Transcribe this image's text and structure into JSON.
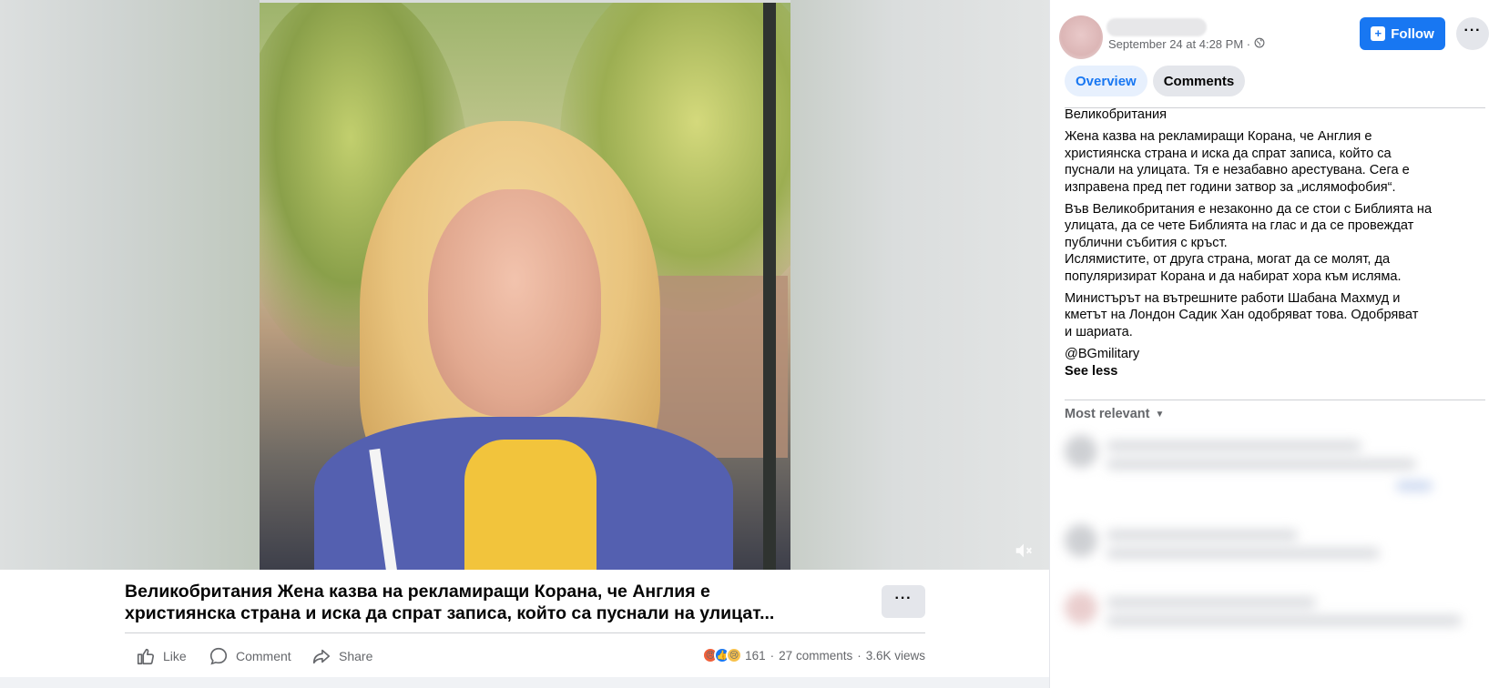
{
  "video": {
    "caption_line1": "Великобритания Жена казва на рекламиращи Корана, че Англия е",
    "caption_line2": "християнска страна и иска да спрат записа, който са пуснали на улицат...",
    "more_label": "···",
    "mute_icon": "mute-icon"
  },
  "actions": {
    "like_label": "Like",
    "comment_label": "Comment",
    "share_label": "Share",
    "reaction_count": "161",
    "comments_count": "27 comments",
    "views": "3.6K views",
    "separator": "·"
  },
  "post": {
    "timestamp": "September 24 at 4:28 PM ·",
    "follow_label": "Follow",
    "more_label": "···",
    "tabs": [
      {
        "label": "Overview"
      },
      {
        "label": "Comments"
      }
    ],
    "paragraphs": [
      [
        "Великобритания"
      ],
      [
        "Жена казва на рекламиращи Корана, че Англия е",
        "християнска страна и иска да спрат записа, който са",
        "пуснали на улицата. Тя е незабавно арестувана. Сега е",
        "изправена пред пет години затвор за „ислямофобия“."
      ],
      [
        "Във Великобритания е незаконно да се стои с Библията на",
        "улицата, да се чете Библията на глас и да се провеждат",
        "публични събития с кръст.",
        "Ислямистите, от друга страна, могат да се молят, да",
        "популяризират Корана и да набират хора към исляма."
      ],
      [
        "Министърът на вътрешните работи Шабана Махмуд и",
        "кметът на Лондон Садик Хан одобряват това. Одобряват",
        "и шариата."
      ]
    ],
    "mention": "@BGmilitary",
    "see_less": "See less",
    "sort_label": "Most relevant"
  },
  "colors": {
    "accent": "#1877f2",
    "text_primary": "#050505",
    "text_secondary": "#65676b",
    "button_gray": "#e4e6eb"
  }
}
